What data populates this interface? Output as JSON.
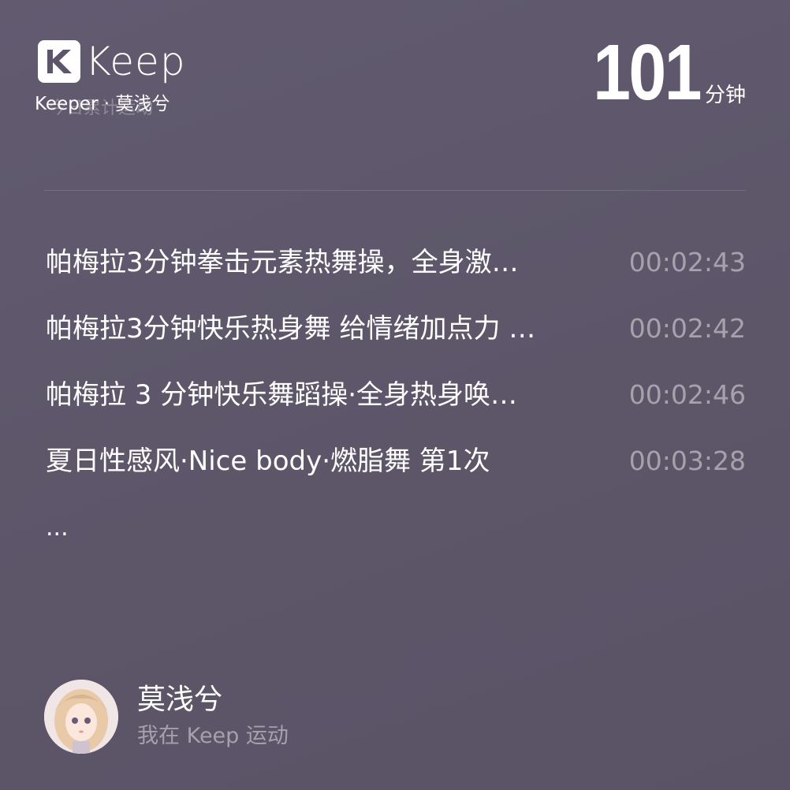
{
  "brand": {
    "logo_text": "Keep"
  },
  "header": {
    "subtitle": "Keeper · 莫浅兮",
    "subtitle_shadow": "今日累计运动"
  },
  "summary": {
    "total_value": "101",
    "total_unit": "分钟"
  },
  "workouts": [
    {
      "title": "帕梅拉3分钟拳击元素热舞操，全身激…",
      "duration": "00:02:43"
    },
    {
      "title": "帕梅拉3分钟快乐热身舞 给情绪加点力 …",
      "duration": "00:02:42"
    },
    {
      "title": "帕梅拉 3 分钟快乐舞蹈操·全身热身唤…",
      "duration": "00:02:46"
    },
    {
      "title": "夏日性感风·Nice body·燃脂舞 第1次",
      "duration": "00:03:28"
    }
  ],
  "more_indicator": "...",
  "user": {
    "name": "莫浅兮",
    "caption": "我在 Keep 运动"
  },
  "colors": {
    "background": "#5d566a",
    "text_primary": "#ffffff",
    "text_secondary": "rgba(255,255,255,0.45)"
  }
}
